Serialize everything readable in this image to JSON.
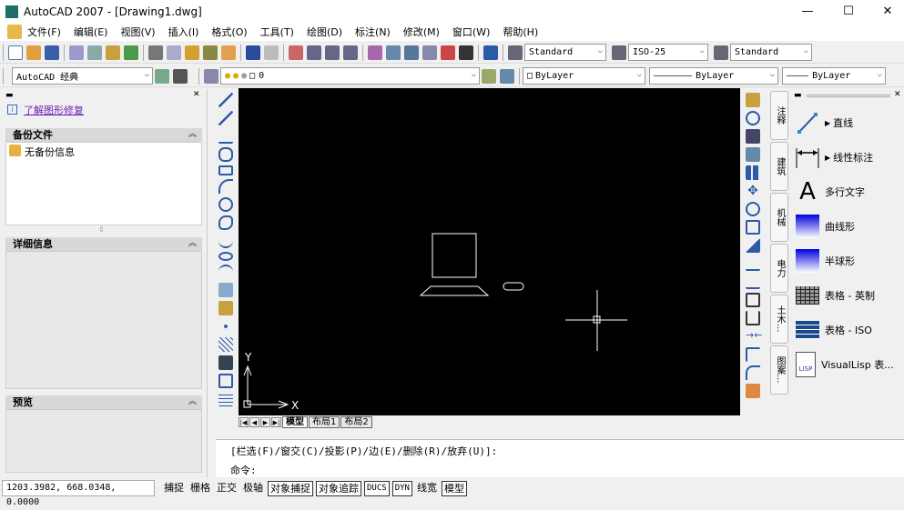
{
  "title": "AutoCAD 2007 - [Drawing1.dwg]",
  "window_controls": {
    "minimize": "—",
    "maximize": "☐",
    "close": "✕"
  },
  "menu": [
    "文件(F)",
    "编辑(E)",
    "视图(V)",
    "插入(I)",
    "格式(O)",
    "工具(T)",
    "绘图(D)",
    "标注(N)",
    "修改(M)",
    "窗口(W)",
    "帮助(H)"
  ],
  "toolbar": {
    "text_style": "Standard",
    "dim_style": "ISO-25",
    "table_style": "Standard",
    "workspace": "AutoCAD 经典",
    "layer": "0",
    "color": "ByLayer",
    "linetype": "ByLayer",
    "lineweight": "ByLayer"
  },
  "left_panel": {
    "link": "了解图形修复",
    "backup_header": "备份文件",
    "backup_item": "无备份信息",
    "details_header": "详细信息",
    "preview_header": "预览"
  },
  "layout_tabs": [
    "模型",
    "布局1",
    "布局2"
  ],
  "palette_tabs": [
    "注释",
    "建筑",
    "机械",
    "电力",
    "土木...",
    "图案..."
  ],
  "palette_items": [
    "直线",
    "线性标注",
    "多行文字",
    "曲线形",
    "半球形",
    "表格 - 英制",
    "表格 - ISO",
    "VisualLisp 表..."
  ],
  "ucs": {
    "x": "X",
    "y": "Y"
  },
  "command": {
    "history": "[栏选(F)/窗交(C)/投影(P)/边(E)/删除(R)/放弃(U)]:",
    "prompt": "命令:"
  },
  "status": {
    "coords": "1203.3982, 668.0348, 0.0000",
    "buttons": [
      {
        "label": "捕捉",
        "on": false
      },
      {
        "label": "栅格",
        "on": false
      },
      {
        "label": "正交",
        "on": false
      },
      {
        "label": "极轴",
        "on": false
      },
      {
        "label": "对象捕捉",
        "on": true
      },
      {
        "label": "对象追踪",
        "on": true
      },
      {
        "label": "DUCS",
        "on": true
      },
      {
        "label": "DYN",
        "on": true
      },
      {
        "label": "线宽",
        "on": false
      },
      {
        "label": "模型",
        "on": true
      }
    ]
  }
}
